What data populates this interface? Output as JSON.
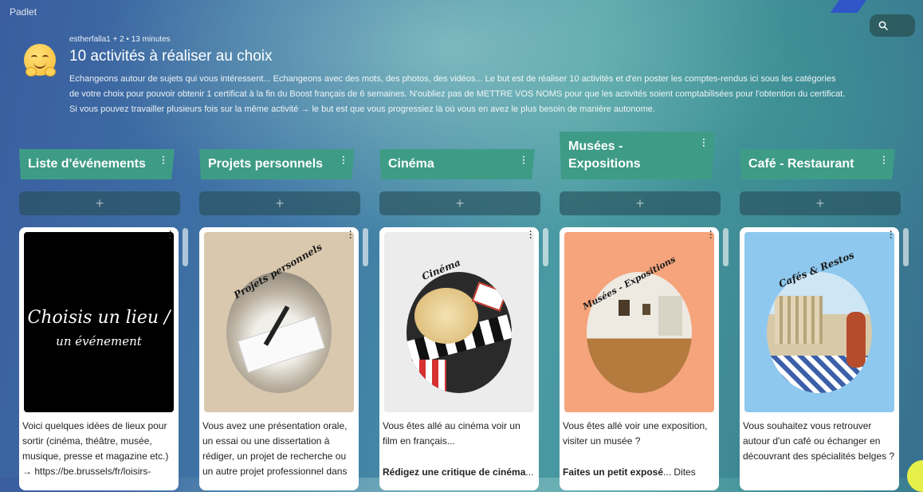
{
  "app": {
    "brand": "Padlet"
  },
  "header": {
    "meta": "estherfalla1 + 2 • 13 minutes",
    "title": "10 activités à réaliser au choix",
    "description": "Echangeons autour de sujets qui vous intéressent... Echangeons avec des mots, des photos, des vidéos... Le but est de réaliser 10 activités et d'en poster les comptes-rendus ici sous les catégories de votre choix pour pouvoir obtenir 1 certificat à la fin du Boost français de 6 semaines. N'oubliez pas de METTRE VOS NOMS pour que les activités soient comptabilisées pour l'obtention du certificat. Si vous pouvez travailler plusieurs fois sur la même activité → le but est que vous progressiez là où vous en avez le plus besoin de manière autonome."
  },
  "columns": [
    {
      "title": "Liste d'événements",
      "add_label": "+",
      "card": {
        "thumb_title_line1": "Choisis un lieu /",
        "thumb_title_line2": "un événement",
        "text": "Voici quelques idées de lieux pour sortir (cinéma, théâtre, musée, musique, presse et magazine etc.) → https://be.brussels/fr/loisirs-",
        "bold": "",
        "text2": ""
      }
    },
    {
      "title": "Projets personnels",
      "add_label": "+",
      "card": {
        "thumb_title": "Projets personnels",
        "text": "Vous avez une présentation orale, un essai ou une dissertation à rédiger, un projet de recherche ou un autre projet professionnel dans",
        "bold": "",
        "text2": ""
      }
    },
    {
      "title": "Cinéma",
      "add_label": "+",
      "card": {
        "thumb_title": "Cinéma",
        "text": "Vous êtes allé au cinéma voir un film en français...",
        "bold": "Rédigez une critique de cinéma",
        "text2": "..."
      }
    },
    {
      "title": "Musées - Expositions",
      "add_label": "+",
      "card": {
        "thumb_title": "Musées - Expositions",
        "text": "Vous êtes allé voir une exposition, visiter un musée ?",
        "bold": "Faites un petit exposé",
        "text2": "... Dites"
      }
    },
    {
      "title": "Café - Restaurant",
      "add_label": "+",
      "card": {
        "thumb_title": "Cafés & Restos",
        "text": "Vous souhaitez vous retrouver autour d'un café ou échanger en découvrant des spécialités belges ?",
        "bold": "",
        "text2": ""
      }
    }
  ],
  "colors": {
    "column_header": "#3e9c86",
    "accent_blue": "#2f55c9",
    "cinema_bg": "#ececec",
    "museum_bg": "#f5a47c",
    "cafe_bg": "#8ec8ee",
    "projects_bg": "#d9c8ad",
    "events_bg": "#000000"
  },
  "icons": {
    "search": "search-icon",
    "menu": "kebab-menu-icon",
    "avatar": "hugging-face-emoji"
  }
}
